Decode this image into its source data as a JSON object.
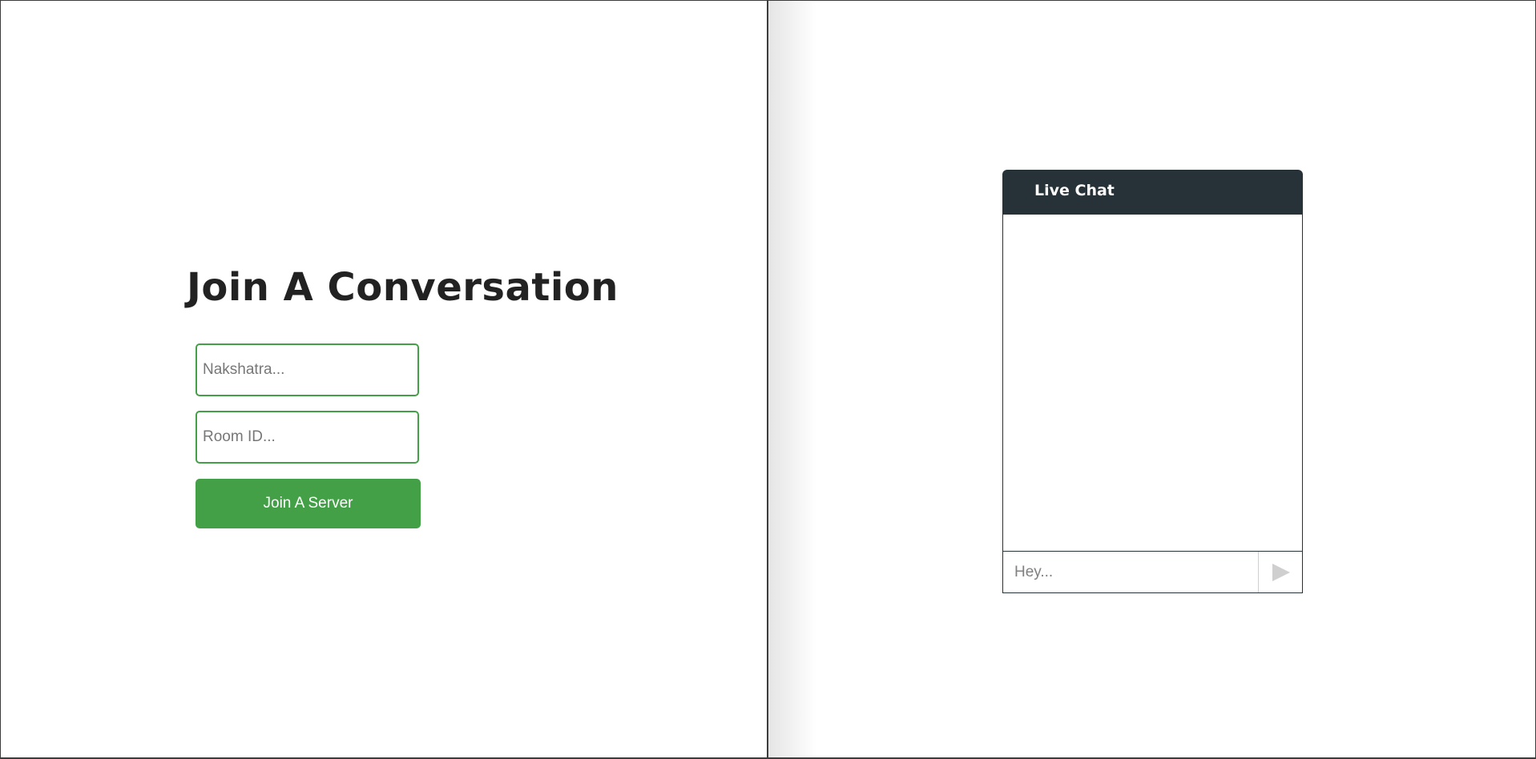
{
  "join": {
    "title": "Join A Conversation",
    "name_placeholder": "Nakshatra...",
    "name_value": "",
    "room_placeholder": "Room ID...",
    "room_value": "",
    "button_label": "Join A Server"
  },
  "chat": {
    "header_title": "Live Chat",
    "messages": [],
    "message_placeholder": "Hey...",
    "message_value": "",
    "send_icon": "play-triangle-icon"
  },
  "colors": {
    "accent_green": "#43a047",
    "chat_header": "#263238",
    "heading_text": "#222222",
    "send_icon": "#cfcfcf"
  }
}
